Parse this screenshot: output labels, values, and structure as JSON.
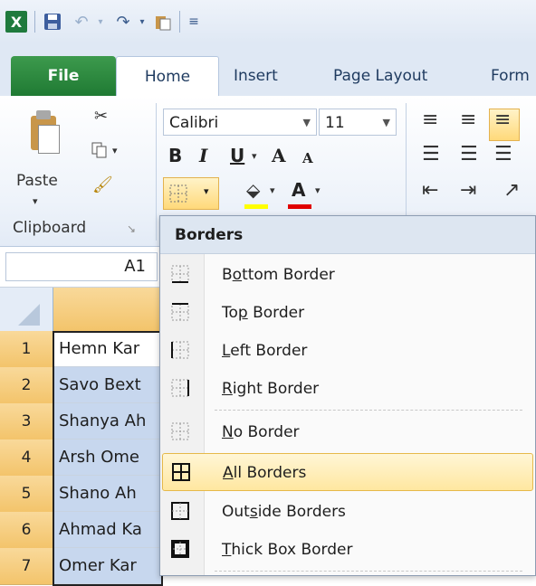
{
  "quick_access": {
    "icons": [
      "excel-logo-icon",
      "save-icon",
      "undo-icon",
      "redo-icon",
      "paste-small-icon",
      "customize-icon"
    ]
  },
  "tabs": [
    {
      "label": "File"
    },
    {
      "label": "Home"
    },
    {
      "label": "Insert"
    },
    {
      "label": "Page Layout"
    },
    {
      "label": "Form"
    }
  ],
  "ribbon": {
    "clipboard": {
      "paste_label": "Paste",
      "group_label": "Clipboard"
    },
    "font": {
      "font_name": "Calibri",
      "font_size": "11",
      "bold": "B",
      "italic": "I",
      "underline": "U",
      "grow": "A",
      "shrink": "A",
      "font_color": "A"
    }
  },
  "formula_bar": {
    "name_box": "A1"
  },
  "sheet": {
    "rows": [
      {
        "num": "1",
        "a": "Hemn Kar"
      },
      {
        "num": "2",
        "a": "Savo Bext"
      },
      {
        "num": "3",
        "a": "Shanya Ah"
      },
      {
        "num": "4",
        "a": "Arsh Ome"
      },
      {
        "num": "5",
        "a": "Shano Ah"
      },
      {
        "num": "6",
        "a": "Ahmad Ka"
      },
      {
        "num": "7",
        "a": "Omer Kar"
      }
    ]
  },
  "borders_menu": {
    "title": "Borders",
    "items": [
      {
        "pre": "B",
        "u": "o",
        "post": "ttom Border"
      },
      {
        "pre": "To",
        "u": "p",
        "post": " Border"
      },
      {
        "pre": "",
        "u": "L",
        "post": "eft Border"
      },
      {
        "pre": "",
        "u": "R",
        "post": "ight Border"
      },
      {
        "pre": "",
        "u": "N",
        "post": "o Border"
      },
      {
        "pre": "",
        "u": "A",
        "post": "ll Borders"
      },
      {
        "pre": "Out",
        "u": "s",
        "post": "ide Borders"
      },
      {
        "pre": "",
        "u": "T",
        "post": "hick Box Border"
      }
    ]
  },
  "colors": {
    "file_tab": "#1f7a33",
    "row_header_selected": "#f3c46b",
    "highlight": "#ffe7a0"
  }
}
